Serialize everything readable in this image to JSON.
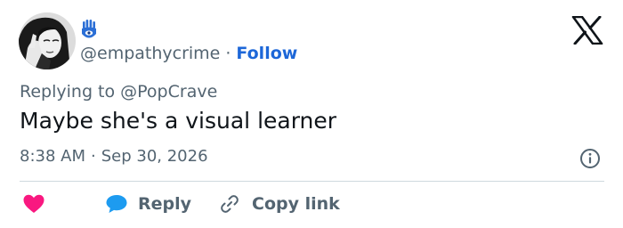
{
  "colors": {
    "accent": "#1d67d8",
    "secondary_text": "#536471",
    "heart": "#f91880",
    "reply_bubble": "#1d9bf0"
  },
  "icons": {
    "display_name": "hamsa-icon",
    "brand": "x-logo-icon",
    "info": "info-icon",
    "like": "heart-icon",
    "reply": "speech-bubble-icon",
    "copy": "link-icon"
  },
  "author": {
    "handle": "@empathycrime",
    "separator": "·",
    "follow_label": "Follow"
  },
  "tweet": {
    "replying_prefix": "Replying to ",
    "replying_user": "@PopCrave",
    "text": "Maybe she's a visual learner",
    "time": "8:38 AM",
    "separator": "·",
    "date": "Sep 30, 2026"
  },
  "actions": {
    "reply_label": "Reply",
    "copy_label": "Copy link"
  }
}
